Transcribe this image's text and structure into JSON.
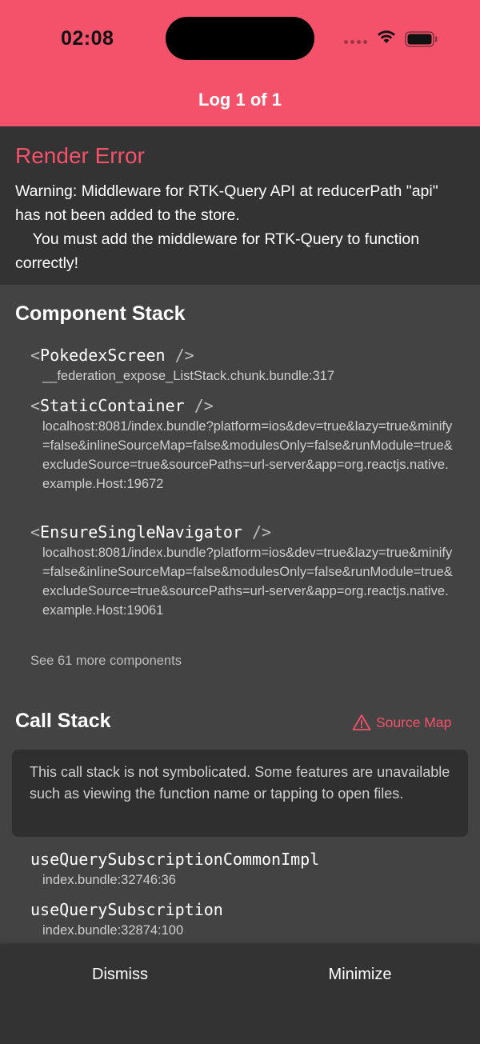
{
  "status_bar": {
    "time": "02:08"
  },
  "header": {
    "title": "Log 1 of 1",
    "color": "#f3526a"
  },
  "error": {
    "title": "Render Error",
    "message": "Warning: Middleware for RTK-Query API at reducerPath \"api\" has not been added to the store.\n    You must add the middleware for RTK-Query to function correctly!"
  },
  "component_stack": {
    "title": "Component Stack",
    "frames": [
      {
        "open": "<",
        "name": "PokedexScreen",
        "close": " />",
        "location": "__federation_expose_ListStack.chunk.bundle:317"
      },
      {
        "open": "<",
        "name": "StaticContainer",
        "close": " />",
        "location": "localhost:8081/index.bundle?platform=ios&dev=true&lazy=true&minify=false&inlineSourceMap=false&modulesOnly=false&runModule=true&excludeSource=true&sourcePaths=url-server&app=org.reactjs.native.example.Host:19672"
      },
      {
        "open": "<",
        "name": "EnsureSingleNavigator",
        "close": " />",
        "location": "localhost:8081/index.bundle?platform=ios&dev=true&lazy=true&minify=false&inlineSourceMap=false&modulesOnly=false&runModule=true&excludeSource=true&sourcePaths=url-server&app=org.reactjs.native.example.Host:19061"
      }
    ],
    "see_more": "See 61 more components"
  },
  "call_stack": {
    "title": "Call Stack",
    "source_map_label": "Source Map",
    "notice": "This call stack is not symbolicated. Some features are unavailable such as viewing the function name or tapping to open files.",
    "frames": [
      {
        "name": "useQuerySubscriptionCommonImpl",
        "location": "index.bundle:32746:36"
      },
      {
        "name": "useQuerySubscription",
        "location": "index.bundle:32874:100"
      }
    ]
  },
  "footer": {
    "dismiss_label": "Dismiss",
    "minimize_label": "Minimize"
  }
}
